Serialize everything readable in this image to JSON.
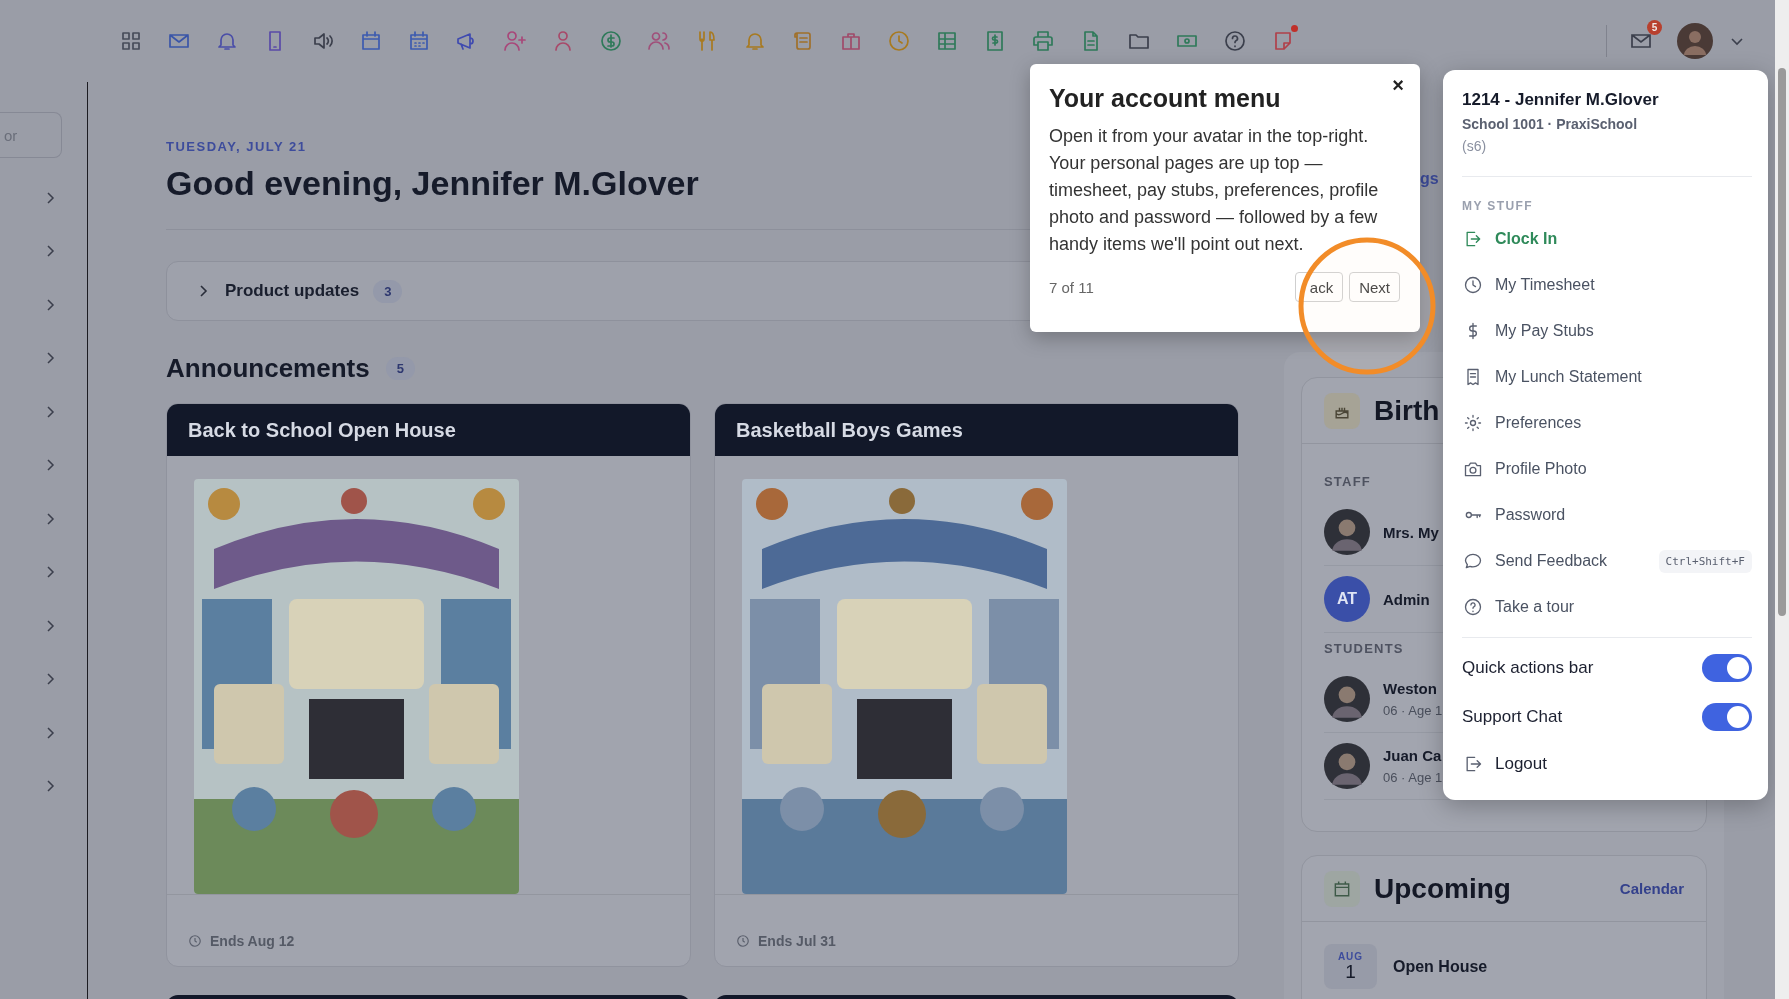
{
  "toolbar": {
    "notes_alert": true
  },
  "header": {
    "mail_badge": "5"
  },
  "sidebar": {
    "search": {
      "placeholder": "or"
    },
    "rows": [
      {
        "expanded": false
      },
      {
        "expanded": false
      },
      {
        "expanded": false
      },
      {
        "expanded": false
      },
      {
        "expanded": false
      },
      {
        "expanded": false
      },
      {
        "expanded": false
      },
      {
        "expanded": false
      },
      {
        "expanded": false
      },
      {
        "expanded": false
      },
      {
        "expanded": false
      },
      {
        "expanded": false
      }
    ]
  },
  "greeting": {
    "date": "TUESDAY, JULY 21",
    "title": "Good evening, Jennifer M.Glover"
  },
  "product_updates": {
    "label": "Product updates",
    "count": "3",
    "expanded": false
  },
  "announcements": {
    "title": "Announcements",
    "count": "5",
    "cards": [
      {
        "kind": "full",
        "title": "Back to School Open House",
        "ends": "Ends Aug 12"
      },
      {
        "kind": "full",
        "title": "Basketball Boys Games",
        "ends": "Ends Jul 31"
      },
      {
        "kind": "cut"
      },
      {
        "kind": "cut"
      }
    ]
  },
  "side_link": "gs",
  "birthdays": {
    "title": "Birth",
    "sections": [
      {
        "label": "STAFF",
        "people": [
          {
            "name": "Mrs. My"
          },
          {
            "name": "Admin",
            "initials": "AT"
          }
        ]
      },
      {
        "label": "STUDENTS",
        "people": [
          {
            "name": "Weston",
            "detail": "06 · Age 1"
          },
          {
            "name": "Juan Ca",
            "detail": "06 · Age 1"
          }
        ]
      }
    ]
  },
  "upcoming": {
    "title": "Upcoming",
    "link": "Calendar",
    "events": [
      {
        "month": "AUG",
        "day": "1",
        "title": "Open House"
      }
    ]
  },
  "account_menu": {
    "title": "1214 - Jennifer M.Glover",
    "subtitle": "School 1001 · PraxiSchool",
    "code": "(s6)",
    "section": "MY STUFF",
    "items": [
      {
        "label": "Clock In",
        "kind": "primary"
      },
      {
        "label": "My Timesheet",
        "kind": "link"
      },
      {
        "label": "My Pay Stubs",
        "kind": "link"
      },
      {
        "label": "My Lunch Statement",
        "kind": "link"
      },
      {
        "label": "Preferences",
        "kind": "link"
      },
      {
        "label": "Profile Photo",
        "kind": "link"
      },
      {
        "label": "Password",
        "kind": "link"
      },
      {
        "label": "Send Feedback",
        "kind": "link",
        "shortcut": "Ctrl+Shift+F"
      },
      {
        "label": "Take a tour",
        "kind": "link"
      }
    ],
    "toggles": [
      {
        "label": "Quick actions bar",
        "on": true
      },
      {
        "label": "Support Chat",
        "on": true
      }
    ],
    "logout": "Logout"
  },
  "tour": {
    "title": "Your account menu",
    "body": "Open it from your avatar in the top-right. Your personal pages are up top — timesheet, pay stubs, preferences, profile photo and password — followed by a few handy items we'll point out next.",
    "step": "7 of 11",
    "back": "ack",
    "next": "Next",
    "close": "×"
  }
}
